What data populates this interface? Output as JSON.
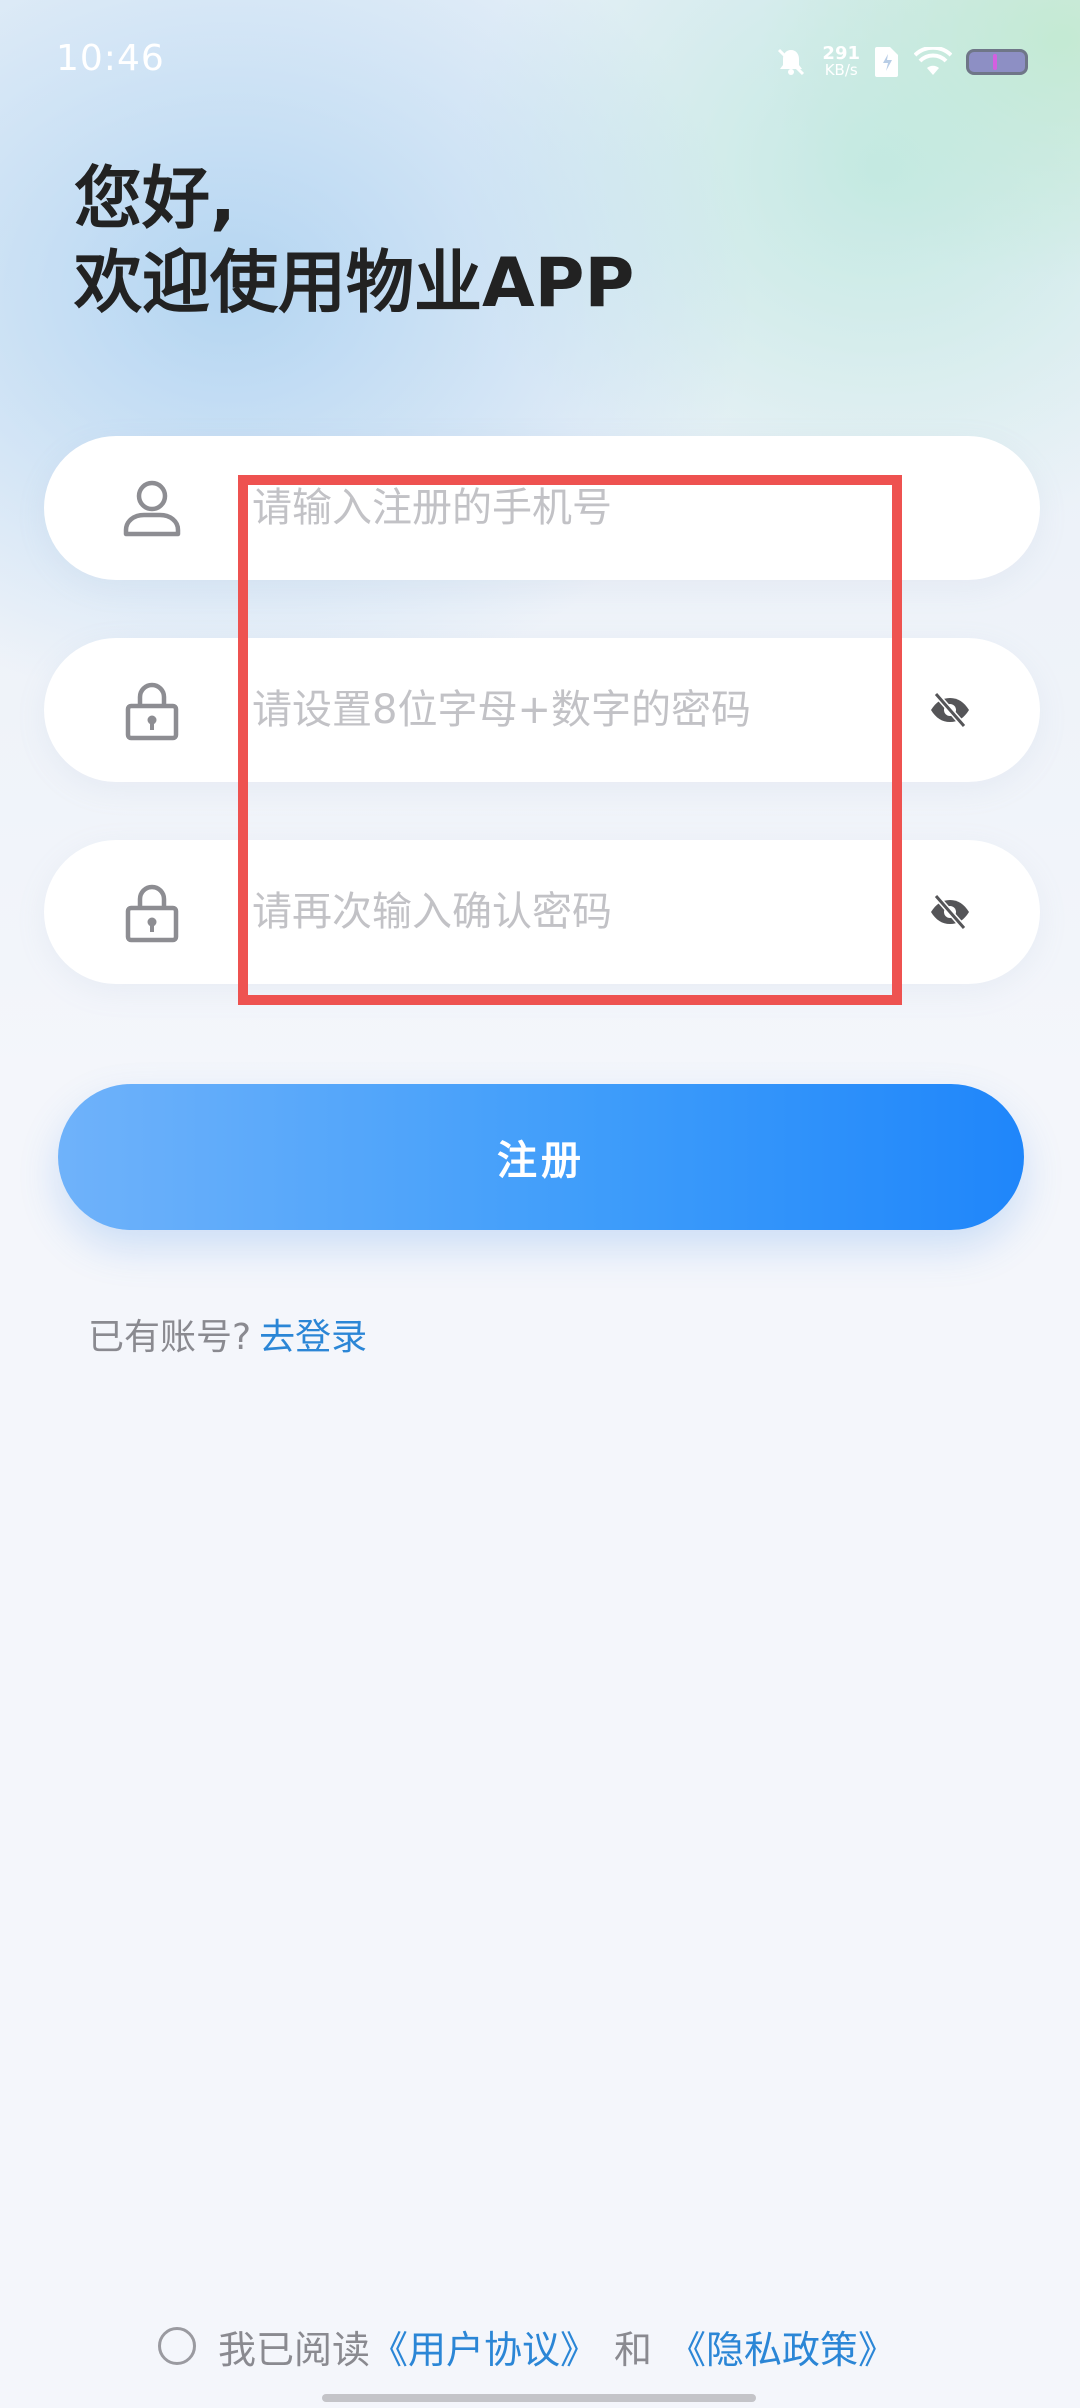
{
  "status_bar": {
    "time": "10:46",
    "net_speed_value": "291",
    "net_speed_unit": "KB/s",
    "icons": [
      "mute-icon",
      "sim-icon",
      "wifi-icon",
      "battery-icon"
    ]
  },
  "greeting": {
    "line1": "您好,",
    "line2": "欢迎使用物业APP"
  },
  "form": {
    "phone_placeholder": "请输入注册的手机号",
    "password_placeholder": "请设置8位字母+数字的密码",
    "confirm_placeholder": "请再次输入确认密码"
  },
  "register_button": "注册",
  "login_prompt": {
    "text": "已有账号?",
    "link": "去登录"
  },
  "agreement": {
    "prefix": "我已阅读",
    "user_agreement": "《用户协议》",
    "and": "和",
    "privacy_policy": "《隐私政策》"
  },
  "colors": {
    "accent": "#1f86fa",
    "link": "#2b86d6",
    "highlight_box": "#ee5250"
  }
}
